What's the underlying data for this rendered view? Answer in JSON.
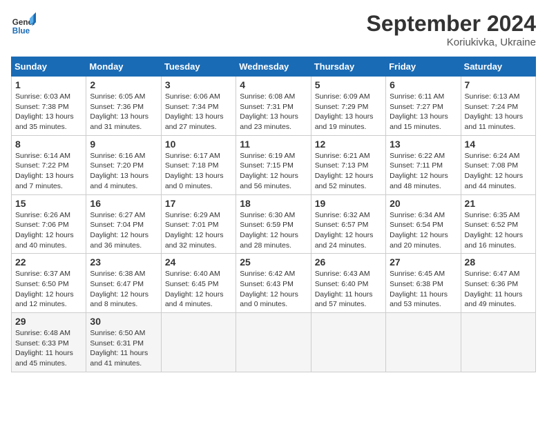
{
  "header": {
    "logo_line1": "General",
    "logo_line2": "Blue",
    "month": "September 2024",
    "location": "Koriukivka, Ukraine"
  },
  "weekdays": [
    "Sunday",
    "Monday",
    "Tuesday",
    "Wednesday",
    "Thursday",
    "Friday",
    "Saturday"
  ],
  "weeks": [
    [
      {
        "day": "1",
        "info": "Sunrise: 6:03 AM\nSunset: 7:38 PM\nDaylight: 13 hours\nand 35 minutes."
      },
      {
        "day": "2",
        "info": "Sunrise: 6:05 AM\nSunset: 7:36 PM\nDaylight: 13 hours\nand 31 minutes."
      },
      {
        "day": "3",
        "info": "Sunrise: 6:06 AM\nSunset: 7:34 PM\nDaylight: 13 hours\nand 27 minutes."
      },
      {
        "day": "4",
        "info": "Sunrise: 6:08 AM\nSunset: 7:31 PM\nDaylight: 13 hours\nand 23 minutes."
      },
      {
        "day": "5",
        "info": "Sunrise: 6:09 AM\nSunset: 7:29 PM\nDaylight: 13 hours\nand 19 minutes."
      },
      {
        "day": "6",
        "info": "Sunrise: 6:11 AM\nSunset: 7:27 PM\nDaylight: 13 hours\nand 15 minutes."
      },
      {
        "day": "7",
        "info": "Sunrise: 6:13 AM\nSunset: 7:24 PM\nDaylight: 13 hours\nand 11 minutes."
      }
    ],
    [
      {
        "day": "8",
        "info": "Sunrise: 6:14 AM\nSunset: 7:22 PM\nDaylight: 13 hours\nand 7 minutes."
      },
      {
        "day": "9",
        "info": "Sunrise: 6:16 AM\nSunset: 7:20 PM\nDaylight: 13 hours\nand 4 minutes."
      },
      {
        "day": "10",
        "info": "Sunrise: 6:17 AM\nSunset: 7:18 PM\nDaylight: 13 hours\nand 0 minutes."
      },
      {
        "day": "11",
        "info": "Sunrise: 6:19 AM\nSunset: 7:15 PM\nDaylight: 12 hours\nand 56 minutes."
      },
      {
        "day": "12",
        "info": "Sunrise: 6:21 AM\nSunset: 7:13 PM\nDaylight: 12 hours\nand 52 minutes."
      },
      {
        "day": "13",
        "info": "Sunrise: 6:22 AM\nSunset: 7:11 PM\nDaylight: 12 hours\nand 48 minutes."
      },
      {
        "day": "14",
        "info": "Sunrise: 6:24 AM\nSunset: 7:08 PM\nDaylight: 12 hours\nand 44 minutes."
      }
    ],
    [
      {
        "day": "15",
        "info": "Sunrise: 6:26 AM\nSunset: 7:06 PM\nDaylight: 12 hours\nand 40 minutes."
      },
      {
        "day": "16",
        "info": "Sunrise: 6:27 AM\nSunset: 7:04 PM\nDaylight: 12 hours\nand 36 minutes."
      },
      {
        "day": "17",
        "info": "Sunrise: 6:29 AM\nSunset: 7:01 PM\nDaylight: 12 hours\nand 32 minutes."
      },
      {
        "day": "18",
        "info": "Sunrise: 6:30 AM\nSunset: 6:59 PM\nDaylight: 12 hours\nand 28 minutes."
      },
      {
        "day": "19",
        "info": "Sunrise: 6:32 AM\nSunset: 6:57 PM\nDaylight: 12 hours\nand 24 minutes."
      },
      {
        "day": "20",
        "info": "Sunrise: 6:34 AM\nSunset: 6:54 PM\nDaylight: 12 hours\nand 20 minutes."
      },
      {
        "day": "21",
        "info": "Sunrise: 6:35 AM\nSunset: 6:52 PM\nDaylight: 12 hours\nand 16 minutes."
      }
    ],
    [
      {
        "day": "22",
        "info": "Sunrise: 6:37 AM\nSunset: 6:50 PM\nDaylight: 12 hours\nand 12 minutes."
      },
      {
        "day": "23",
        "info": "Sunrise: 6:38 AM\nSunset: 6:47 PM\nDaylight: 12 hours\nand 8 minutes."
      },
      {
        "day": "24",
        "info": "Sunrise: 6:40 AM\nSunset: 6:45 PM\nDaylight: 12 hours\nand 4 minutes."
      },
      {
        "day": "25",
        "info": "Sunrise: 6:42 AM\nSunset: 6:43 PM\nDaylight: 12 hours\nand 0 minutes."
      },
      {
        "day": "26",
        "info": "Sunrise: 6:43 AM\nSunset: 6:40 PM\nDaylight: 11 hours\nand 57 minutes."
      },
      {
        "day": "27",
        "info": "Sunrise: 6:45 AM\nSunset: 6:38 PM\nDaylight: 11 hours\nand 53 minutes."
      },
      {
        "day": "28",
        "info": "Sunrise: 6:47 AM\nSunset: 6:36 PM\nDaylight: 11 hours\nand 49 minutes."
      }
    ],
    [
      {
        "day": "29",
        "info": "Sunrise: 6:48 AM\nSunset: 6:33 PM\nDaylight: 11 hours\nand 45 minutes."
      },
      {
        "day": "30",
        "info": "Sunrise: 6:50 AM\nSunset: 6:31 PM\nDaylight: 11 hours\nand 41 minutes."
      },
      null,
      null,
      null,
      null,
      null
    ]
  ]
}
